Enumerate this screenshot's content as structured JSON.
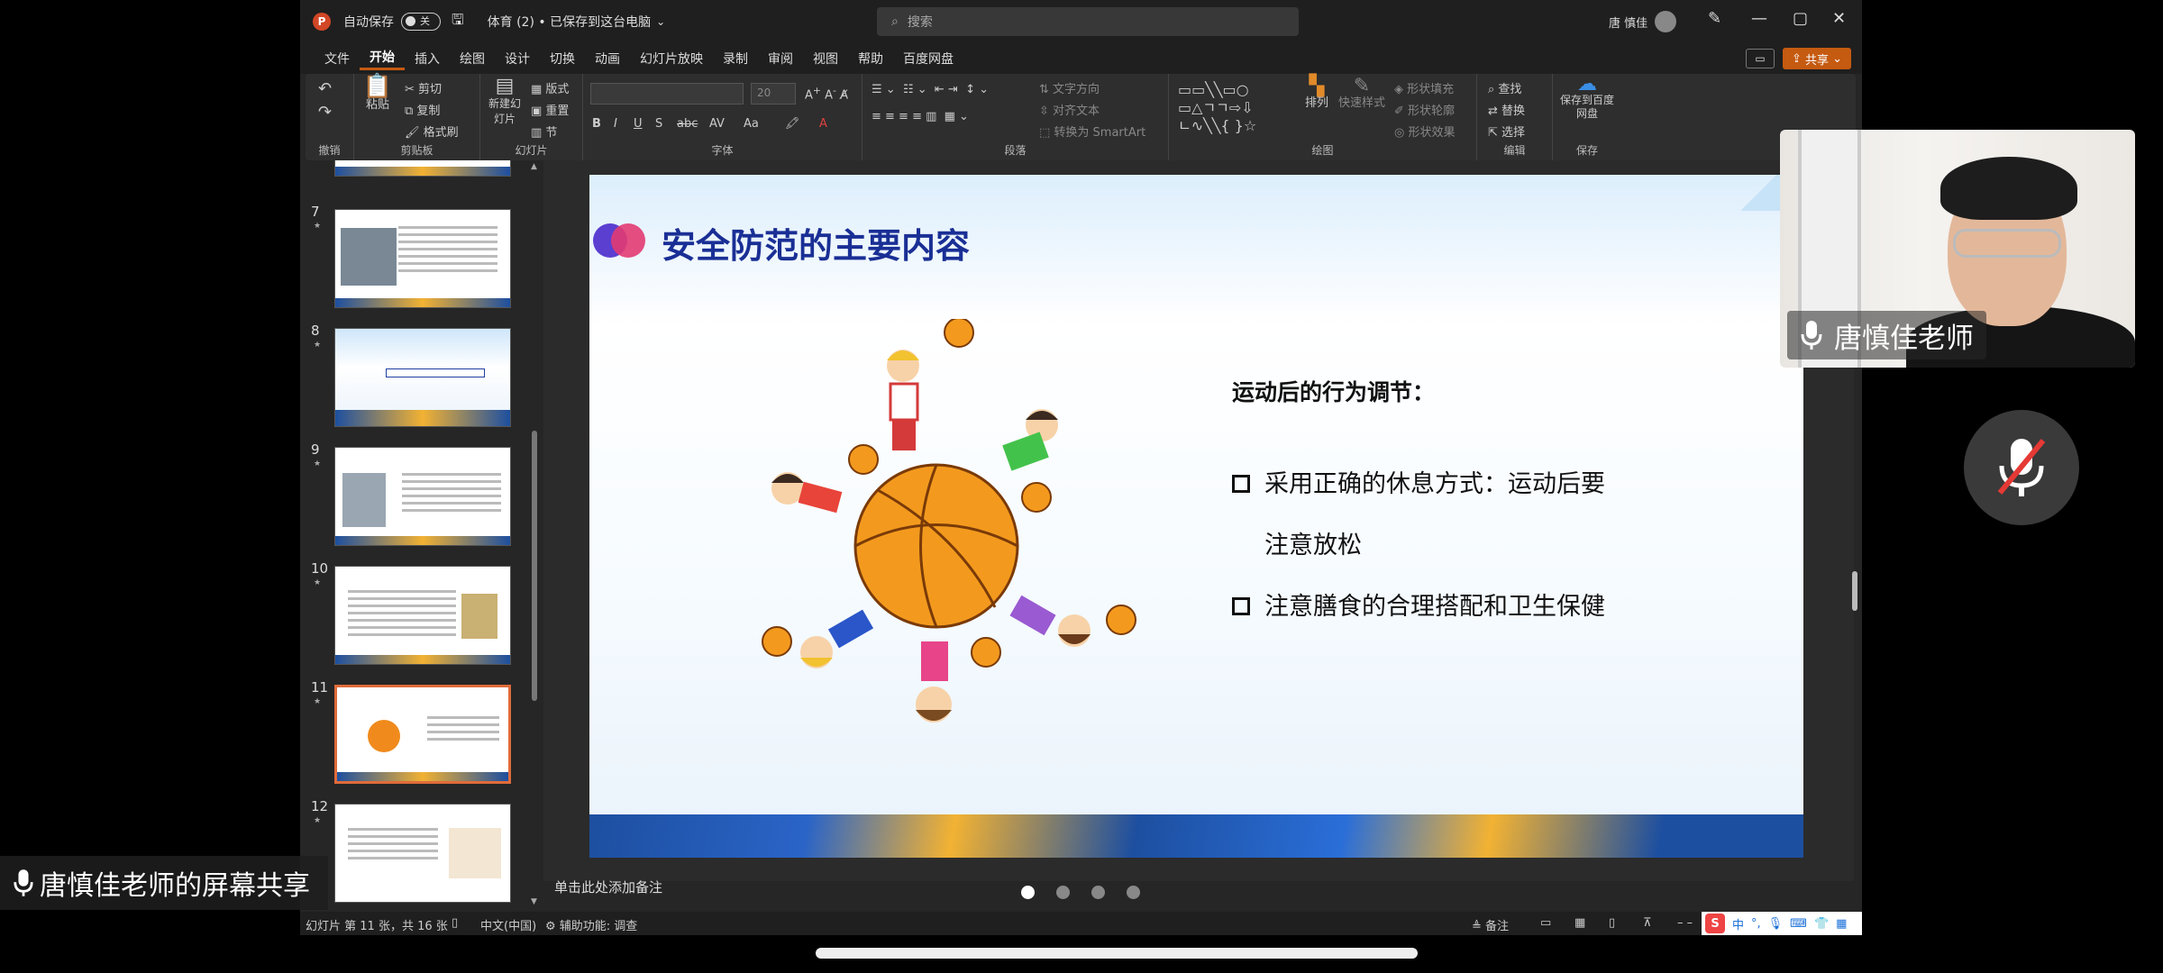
{
  "app": {
    "autosave_label": "自动保存",
    "autosave_state": "关",
    "doc_title": "体育 (2) • 已保存到这台电脑",
    "search_placeholder": "搜索",
    "user_name": "唐 慎佳"
  },
  "menu": {
    "items": [
      "文件",
      "开始",
      "插入",
      "绘图",
      "设计",
      "切换",
      "动画",
      "幻灯片放映",
      "录制",
      "审阅",
      "视图",
      "帮助",
      "百度网盘"
    ],
    "active": "开始",
    "share_label": "共享"
  },
  "ribbon": {
    "undo_group": "撤销",
    "clipboard": {
      "paste": "粘贴",
      "cut": "剪切",
      "copy": "复制",
      "format_painter": "格式刷",
      "label": "剪贴板"
    },
    "slides": {
      "new_slide": "新建幻灯片",
      "layout": "版式",
      "reset": "重置",
      "section": "节",
      "label": "幻灯片"
    },
    "font": {
      "size": "20",
      "label": "字体"
    },
    "paragraph": {
      "text_direction": "文字方向",
      "align_text": "对齐文本",
      "smartart": "转换为 SmartArt",
      "label": "段落"
    },
    "drawing": {
      "arrange": "排列",
      "quick_styles": "快速样式",
      "shape_fill": "形状填充",
      "shape_outline": "形状轮廓",
      "shape_effects": "形状效果",
      "label": "绘图"
    },
    "editing": {
      "find": "查找",
      "replace": "替换",
      "select": "选择",
      "label": "编辑"
    },
    "save": {
      "save_to": "保存到百度网盘",
      "label": "保存"
    }
  },
  "thumbnails": [
    {
      "num": "7"
    },
    {
      "num": "8"
    },
    {
      "num": "9"
    },
    {
      "num": "10"
    },
    {
      "num": "11",
      "selected": true
    },
    {
      "num": "12"
    }
  ],
  "slide": {
    "title": "安全防范的主要内容",
    "subtitle": "运动后的行为调节：",
    "bullets": [
      "采用正确的休息方式：运动后要",
      "注意放松",
      "注意膳食的合理搭配和卫生保健"
    ]
  },
  "notes_placeholder": "单击此处添加备注",
  "status": {
    "slide_pos": "幻灯片 第 11 张，共 16 张",
    "language": "中文(中国)",
    "accessibility": "辅助功能: 调查",
    "notes": "备注",
    "ime_lang": "中"
  },
  "meeting": {
    "speaker_name": "唐慎佳老师",
    "screen_share_label": "唐慎佳老师的屏幕共享"
  }
}
